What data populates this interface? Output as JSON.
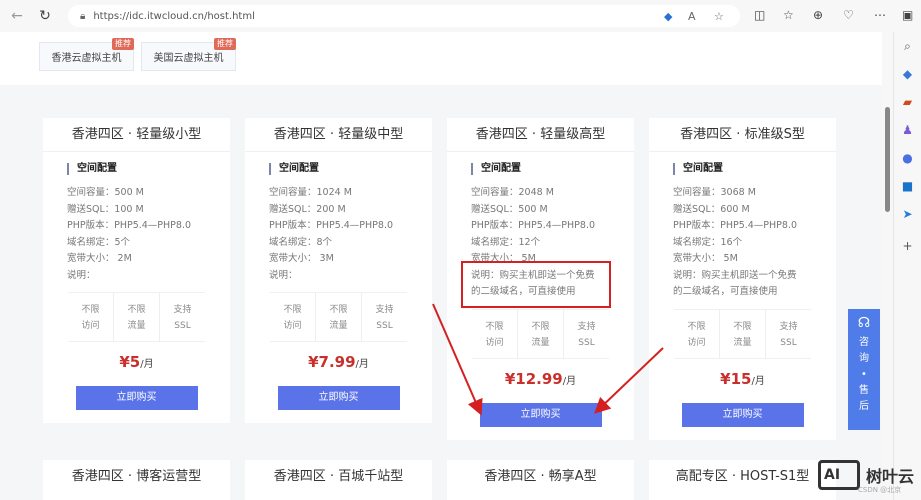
{
  "browser": {
    "url": "https://idc.itwcloud.cn/host.html"
  },
  "tabs": [
    {
      "label": "香港云虚拟主机",
      "badge": "推荐"
    },
    {
      "label": "美国云虚拟主机",
      "badge": "推荐"
    }
  ],
  "section_label": "空间配置",
  "buy_label": "立即购买",
  "features": [
    [
      "不限",
      "访问"
    ],
    [
      "不限",
      "流量"
    ],
    [
      "支持",
      "SSL"
    ]
  ],
  "plans": [
    {
      "title": "香港四区 · 轻量级小型",
      "specs": [
        "空间容量：500 M",
        "赠送SQL：100 M",
        "PHP版本：PHP5.4—PHP8.0",
        "域名绑定：5个",
        "宽带大小： 2M",
        "说明："
      ],
      "price": "¥5",
      "unit": "/月"
    },
    {
      "title": "香港四区 · 轻量级中型",
      "specs": [
        "空间容量：1024 M",
        "赠送SQL：200 M",
        "PHP版本：PHP5.4—PHP8.0",
        "域名绑定：8个",
        "宽带大小： 3M",
        "说明："
      ],
      "price": "¥7.99",
      "unit": "/月"
    },
    {
      "title": "香港四区 · 轻量级高型",
      "specs": [
        "空间容量：2048 M",
        "赠送SQL：500 M",
        "PHP版本：PHP5.4—PHP8.0",
        "域名绑定：12个",
        "宽带大小： 5M",
        "说明：购买主机即送一个免费",
        "的二级域名，可直接使用"
      ],
      "price": "¥12.99",
      "unit": "/月"
    },
    {
      "title": "香港四区 · 标准级S型",
      "specs": [
        "空间容量：3068 M",
        "赠送SQL：600 M",
        "PHP版本：PHP5.4—PHP8.0",
        "域名绑定：16个",
        "宽带大小： 5M",
        "说明：购买主机即送一个免费",
        "的二级域名，可直接使用"
      ],
      "price": "¥15",
      "unit": "/月"
    }
  ],
  "more_plans": [
    "香港四区 · 博客运营型",
    "香港四区 · 百城千站型",
    "香港四区 · 畅享A型",
    "高配专区 · HOST-S1型"
  ],
  "consult": [
    "咨",
    "询",
    "•",
    "售",
    "后"
  ],
  "watermark": {
    "logo": "AI",
    "name": "树叶云",
    "source": "CSDN @北京"
  },
  "colors": {
    "accent": "#5b73e8",
    "price": "#c9302c",
    "annotation": "#d42020"
  }
}
